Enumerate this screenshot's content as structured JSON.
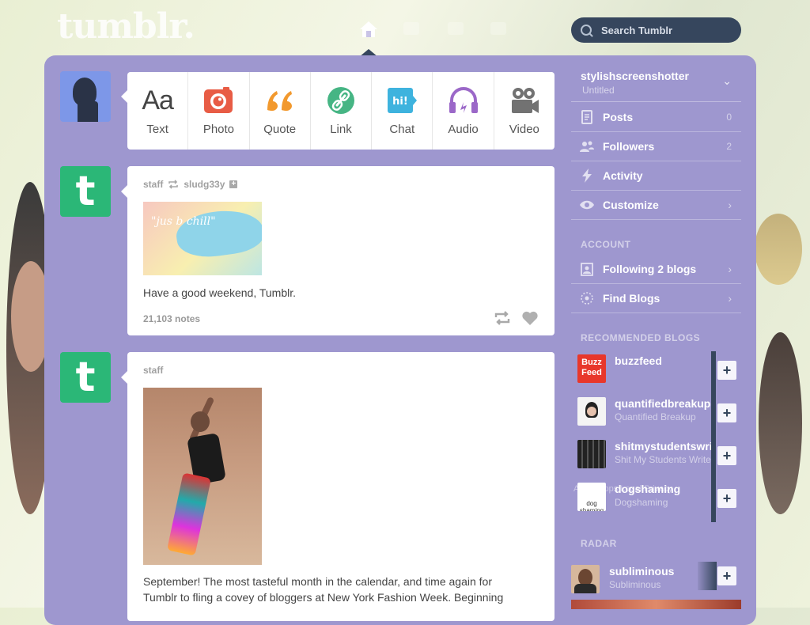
{
  "header": {
    "logo": "tumblr.",
    "search_placeholder": "Search Tumblr"
  },
  "composer": {
    "types": [
      {
        "label": "Text",
        "icon": "text-icon",
        "glyph": "Aa"
      },
      {
        "label": "Photo",
        "icon": "camera-icon"
      },
      {
        "label": "Quote",
        "icon": "quote-icon",
        "glyph": "“"
      },
      {
        "label": "Link",
        "icon": "link-icon"
      },
      {
        "label": "Chat",
        "icon": "chat-icon",
        "glyph": "hi!"
      },
      {
        "label": "Audio",
        "icon": "headphones-icon"
      },
      {
        "label": "Video",
        "icon": "video-camera-icon"
      }
    ]
  },
  "posts": [
    {
      "author": "staff",
      "reblogged_from": "sludg33y",
      "image_caption": "\"jus b chill\"",
      "body": "Have a good weekend, Tumblr.",
      "notes": "21,103 notes"
    },
    {
      "author": "staff",
      "body": "September! The most tasteful month in the calendar, and time again for Tumblr to fling a covey of bloggers at New York Fashion Week. Beginning"
    }
  ],
  "sidebar": {
    "blog": {
      "name": "stylishscreenshotter",
      "title": "Untitled"
    },
    "items": [
      {
        "label": "Posts",
        "count": "0",
        "icon": "posts-icon"
      },
      {
        "label": "Followers",
        "count": "2",
        "icon": "followers-icon"
      },
      {
        "label": "Activity",
        "icon": "lightning-icon"
      },
      {
        "label": "Customize",
        "icon": "eye-icon"
      }
    ],
    "account_heading": "ACCOUNT",
    "account_items": [
      {
        "label": "Following 2 blogs",
        "icon": "following-icon"
      },
      {
        "label": "Find Blogs",
        "icon": "find-blogs-icon"
      }
    ],
    "recommended_heading": "RECOMMENDED BLOGS",
    "recommended": [
      {
        "name": "buzzfeed",
        "title": "",
        "avatar_text": "Buzz Feed"
      },
      {
        "name": "quantifiedbreakup",
        "title": "Quantified Breakup"
      },
      {
        "name": "shitmystudentswrite",
        "title": "Shit My Students Write"
      },
      {
        "name": "dogshaming",
        "title": "Dogshaming",
        "avatar_text": "dog shaming"
      }
    ],
    "radar_heading": "RADAR",
    "radar": {
      "name": "subliminous",
      "title": "Subliminous"
    },
    "footer_ghost": "About  Apps  Legal  Privacy"
  },
  "colors": {
    "panel": "#9e97cf",
    "navy": "#36465d",
    "tumblr_green": "#2bb777",
    "photo_red": "#e85c45",
    "quote_orange": "#f2992e",
    "link_green": "#46b584",
    "chat_blue": "#3eb3de",
    "audio_purple": "#9b68c8",
    "video_gray": "#727272"
  }
}
